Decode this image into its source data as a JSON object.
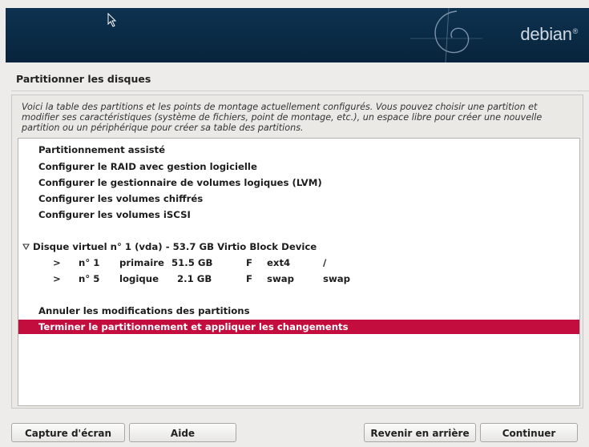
{
  "banner": {
    "logo_text": "debian",
    "logo_mark": "®"
  },
  "page": {
    "title": "Partitionner les disques",
    "intro": "Voici la table des partitions et les points de montage actuellement configurés. Vous pouvez choisir une partition et modifier ses caractéristiques (système de fichiers, point de montage, etc.), un espace libre pour créer une nouvelle partition ou un périphérique pour créer sa table des partitions."
  },
  "menu": {
    "items": [
      "Partitionnement assisté",
      "Configurer le RAID avec gestion logicielle",
      "Configurer le gestionnaire de volumes logiques (LVM)",
      "Configurer les volumes chiffrés",
      "Configurer les volumes iSCSI"
    ],
    "disk": "Disque virtuel n° 1 (vda) - 53.7 GB Virtio Block Device",
    "partitions": [
      {
        "arrow": ">",
        "num": "n° 1",
        "type": "primaire",
        "size": "51.5 GB",
        "flag": "F",
        "fs": "ext4",
        "mount": "/"
      },
      {
        "arrow": ">",
        "num": "n° 5",
        "type": "logique",
        "size": "2.1 GB",
        "flag": "F",
        "fs": "swap",
        "mount": "swap"
      }
    ],
    "undo": "Annuler les modifications des partitions",
    "finish": "Terminer le partitionnement et appliquer les changements"
  },
  "buttons": {
    "screenshot": "Capture d'écran",
    "help": "Aide",
    "back": "Revenir en arrière",
    "continue": "Continuer"
  },
  "colors": {
    "banner": "#0d3250",
    "selection": "#c30d3e"
  }
}
